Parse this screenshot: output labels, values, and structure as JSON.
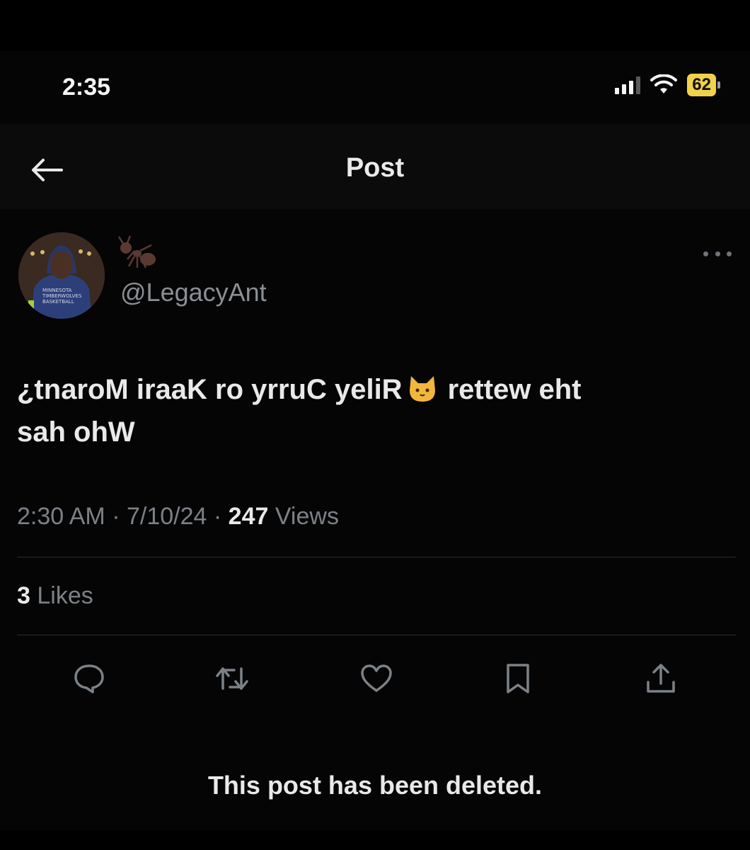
{
  "status_bar": {
    "time": "2:35",
    "battery": "62",
    "icons": [
      "signal-icon",
      "wifi-icon",
      "battery-icon"
    ]
  },
  "header": {
    "title": "Post",
    "back_icon": "arrow-left-icon"
  },
  "post": {
    "handle": "@LegacyAnt",
    "name_icon": "ant-emoji",
    "more_icon": "more-horizontal-icon",
    "text_line1_a": "¿tnaroM iraaK ro yrruC yeliR",
    "text_line1_b": "rettew eht",
    "text_line2": "sah ohW",
    "inline_icon": "cat-face-emoji",
    "meta": {
      "time": "2:30 AM",
      "sep1": "·",
      "date": "7/10/24",
      "sep2": "·",
      "views_count": "247",
      "views_label": "Views"
    },
    "likes": {
      "count": "3",
      "label": "Likes"
    }
  },
  "actions": [
    {
      "name": "reply",
      "icon": "comment-icon"
    },
    {
      "name": "repost",
      "icon": "repost-icon"
    },
    {
      "name": "like",
      "icon": "heart-icon"
    },
    {
      "name": "bookmark",
      "icon": "bookmark-icon"
    },
    {
      "name": "share",
      "icon": "share-icon"
    }
  ],
  "notice": "This post has been deleted.",
  "colors": {
    "background": "#000000",
    "text_primary": "#e9e9e9",
    "text_secondary": "#7c8187",
    "battery": "#f1d24a"
  }
}
